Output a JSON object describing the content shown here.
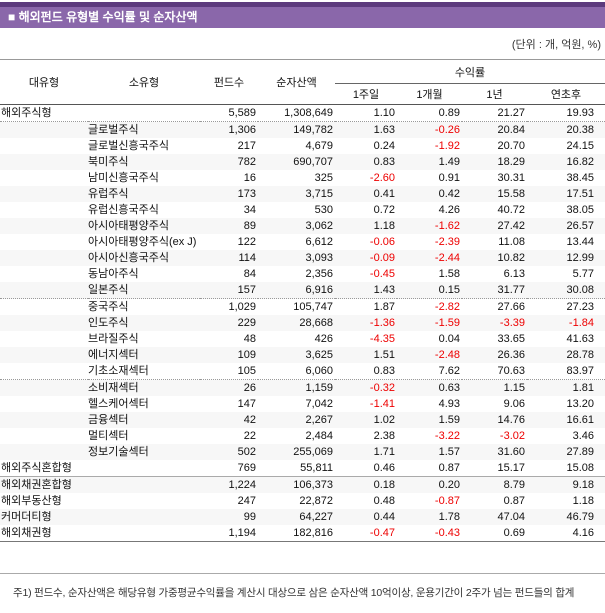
{
  "title": "■ 해외펀드 유형별 수익률 및 순자산액",
  "unit_label": "(단위 : 개, 억원, %)",
  "colors": {
    "banner_dark": "#5c3a7d",
    "banner_main": "#8a67aa",
    "negative_value": "#ee0000"
  },
  "table": {
    "headers": {
      "main_type": "대유형",
      "sub_type": "소유형",
      "fund_count": "펀드수",
      "net_assets": "순자산액",
      "returns_group": "수익률",
      "return_cols": [
        "1주일",
        "1개월",
        "1년",
        "연초후"
      ]
    },
    "rows": [
      {
        "main": "해외주식형",
        "sub": "",
        "count": "5,589",
        "assets": "1,308,649",
        "w1": "1.10",
        "m1": "0.89",
        "y1": "21.27",
        "ytd": "19.93",
        "divider": "dotted"
      },
      {
        "main": "",
        "sub": "글로벌주식",
        "count": "1,306",
        "assets": "149,782",
        "w1": "1.63",
        "m1": "-0.26",
        "y1": "20.84",
        "ytd": "20.38"
      },
      {
        "main": "",
        "sub": "글로벌신흥국주식",
        "count": "217",
        "assets": "4,679",
        "w1": "0.24",
        "m1": "-1.92",
        "y1": "20.70",
        "ytd": "24.15"
      },
      {
        "main": "",
        "sub": "북미주식",
        "count": "782",
        "assets": "690,707",
        "w1": "0.83",
        "m1": "1.49",
        "y1": "18.29",
        "ytd": "16.82"
      },
      {
        "main": "",
        "sub": "남미신흥국주식",
        "count": "16",
        "assets": "325",
        "w1": "-2.60",
        "m1": "0.91",
        "y1": "30.31",
        "ytd": "38.45"
      },
      {
        "main": "",
        "sub": "유럽주식",
        "count": "173",
        "assets": "3,715",
        "w1": "0.41",
        "m1": "0.42",
        "y1": "15.58",
        "ytd": "17.51"
      },
      {
        "main": "",
        "sub": "유럽신흥국주식",
        "count": "34",
        "assets": "530",
        "w1": "0.72",
        "m1": "4.26",
        "y1": "40.72",
        "ytd": "38.05"
      },
      {
        "main": "",
        "sub": "아시아태평양주식",
        "count": "89",
        "assets": "3,062",
        "w1": "1.18",
        "m1": "-1.62",
        "y1": "27.42",
        "ytd": "26.57"
      },
      {
        "main": "",
        "sub": "아시아태평양주식(ex J)",
        "count": "122",
        "assets": "6,612",
        "w1": "-0.06",
        "m1": "-2.39",
        "y1": "11.08",
        "ytd": "13.44"
      },
      {
        "main": "",
        "sub": "아시아신흥국주식",
        "count": "114",
        "assets": "3,093",
        "w1": "-0.09",
        "m1": "-2.44",
        "y1": "10.82",
        "ytd": "12.99"
      },
      {
        "main": "",
        "sub": "동남아주식",
        "count": "84",
        "assets": "2,356",
        "w1": "-0.45",
        "m1": "1.58",
        "y1": "6.13",
        "ytd": "5.77"
      },
      {
        "main": "",
        "sub": "일본주식",
        "count": "157",
        "assets": "6,916",
        "w1": "1.43",
        "m1": "0.15",
        "y1": "31.77",
        "ytd": "30.08",
        "divider": "dotted"
      },
      {
        "main": "",
        "sub": "중국주식",
        "count": "1,029",
        "assets": "105,747",
        "w1": "1.87",
        "m1": "-2.82",
        "y1": "27.66",
        "ytd": "27.23"
      },
      {
        "main": "",
        "sub": "인도주식",
        "count": "229",
        "assets": "28,668",
        "w1": "-1.36",
        "m1": "-1.59",
        "y1": "-3.39",
        "ytd": "-1.84"
      },
      {
        "main": "",
        "sub": "브라질주식",
        "count": "48",
        "assets": "426",
        "w1": "-4.35",
        "m1": "0.04",
        "y1": "33.65",
        "ytd": "41.63"
      },
      {
        "main": "",
        "sub": "에너지섹터",
        "count": "109",
        "assets": "3,625",
        "w1": "1.51",
        "m1": "-2.48",
        "y1": "26.36",
        "ytd": "28.78"
      },
      {
        "main": "",
        "sub": "기초소재섹터",
        "count": "105",
        "assets": "6,060",
        "w1": "0.83",
        "m1": "7.62",
        "y1": "70.63",
        "ytd": "83.97",
        "divider": "dotted"
      },
      {
        "main": "",
        "sub": "소비재섹터",
        "count": "26",
        "assets": "1,159",
        "w1": "-0.32",
        "m1": "0.63",
        "y1": "1.15",
        "ytd": "1.81"
      },
      {
        "main": "",
        "sub": "헬스케어섹터",
        "count": "147",
        "assets": "7,042",
        "w1": "-1.41",
        "m1": "4.93",
        "y1": "9.06",
        "ytd": "13.20"
      },
      {
        "main": "",
        "sub": "금융섹터",
        "count": "42",
        "assets": "2,267",
        "w1": "1.02",
        "m1": "1.59",
        "y1": "14.76",
        "ytd": "16.61"
      },
      {
        "main": "",
        "sub": "멀티섹터",
        "count": "22",
        "assets": "2,484",
        "w1": "2.38",
        "m1": "-3.22",
        "y1": "-3.02",
        "ytd": "3.46"
      },
      {
        "main": "",
        "sub": "정보기술섹터",
        "count": "502",
        "assets": "255,069",
        "w1": "1.71",
        "m1": "1.57",
        "y1": "31.60",
        "ytd": "27.89"
      },
      {
        "main": "해외주식혼합형",
        "sub": "",
        "count": "769",
        "assets": "55,811",
        "w1": "0.46",
        "m1": "0.87",
        "y1": "15.17",
        "ytd": "15.08",
        "divider": "solid"
      },
      {
        "main": "해외채권혼합형",
        "sub": "",
        "count": "1,224",
        "assets": "106,373",
        "w1": "0.18",
        "m1": "0.20",
        "y1": "8.79",
        "ytd": "9.18"
      },
      {
        "main": "해외부동산형",
        "sub": "",
        "count": "247",
        "assets": "22,872",
        "w1": "0.48",
        "m1": "-0.87",
        "y1": "0.87",
        "ytd": "1.18"
      },
      {
        "main": "커머더티형",
        "sub": "",
        "count": "99",
        "assets": "64,227",
        "w1": "0.44",
        "m1": "1.78",
        "y1": "47.04",
        "ytd": "46.79"
      },
      {
        "main": "해외채권형",
        "sub": "",
        "count": "1,194",
        "assets": "182,816",
        "w1": "-0.47",
        "m1": "-0.43",
        "y1": "0.69",
        "ytd": "4.16"
      }
    ]
  },
  "footnote": "주1) 펀드수, 순자산액은 해당유형 가중평균수익률을 계산시 대상으로 삼은 순자산액 10억이상, 운용기간이 2주가 넘는 펀드들의 합계"
}
